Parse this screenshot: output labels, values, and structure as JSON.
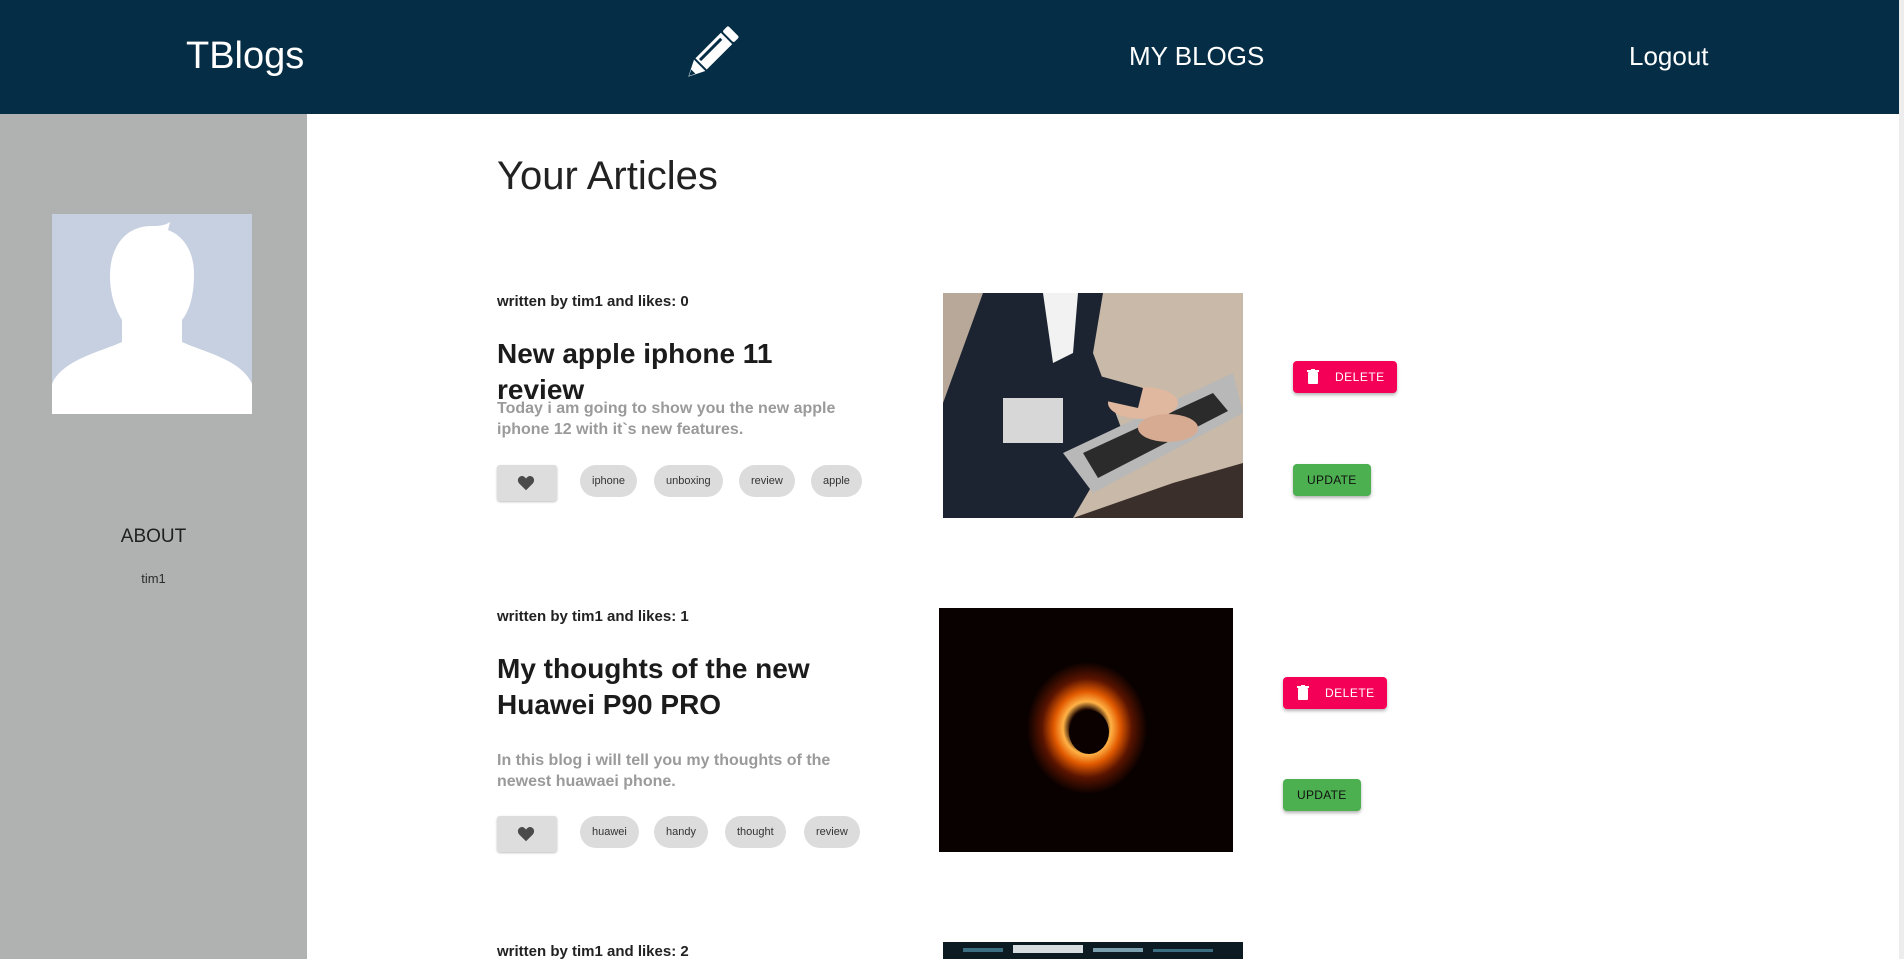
{
  "header": {
    "brand": "TBlogs",
    "write_icon": "pencil-icon",
    "nav_myblogs": "MY BLOGS",
    "nav_logout": "Logout",
    "bg_color": "#052d45"
  },
  "sidebar": {
    "avatar_icon": "user-silhouette-icon",
    "about_label": "ABOUT",
    "username": "tim1",
    "bg_color": "#b0b2b1"
  },
  "main": {
    "page_title": "Your Articles",
    "articles": [
      {
        "meta": "written by tim1 and likes: 0",
        "title": "New apple iphone 11 review",
        "excerpt": "Today i am going to show you the new apple iphone 12 with it`s new features.",
        "tags": [
          "iphone",
          "unboxing",
          "review",
          "apple"
        ],
        "image_icon": "laptop-photo",
        "delete_label": "DELETE",
        "update_label": "UPDATE"
      },
      {
        "meta": "written by tim1 and likes: 1",
        "title": "My thoughts of the new Huawei P90 PRO",
        "excerpt": "In this blog i will tell you my thoughts of the newest huawaei phone.",
        "tags": [
          "huawei",
          "handy",
          "thought",
          "review"
        ],
        "image_icon": "black-hole-photo",
        "delete_label": "DELETE",
        "update_label": "UPDATE"
      },
      {
        "meta": "written by tim1 and likes: 2",
        "image_icon": "code-screen-photo"
      }
    ]
  },
  "colors": {
    "delete": "#f50057",
    "update": "#4caf50",
    "tag_bg": "#dcdcdc"
  }
}
